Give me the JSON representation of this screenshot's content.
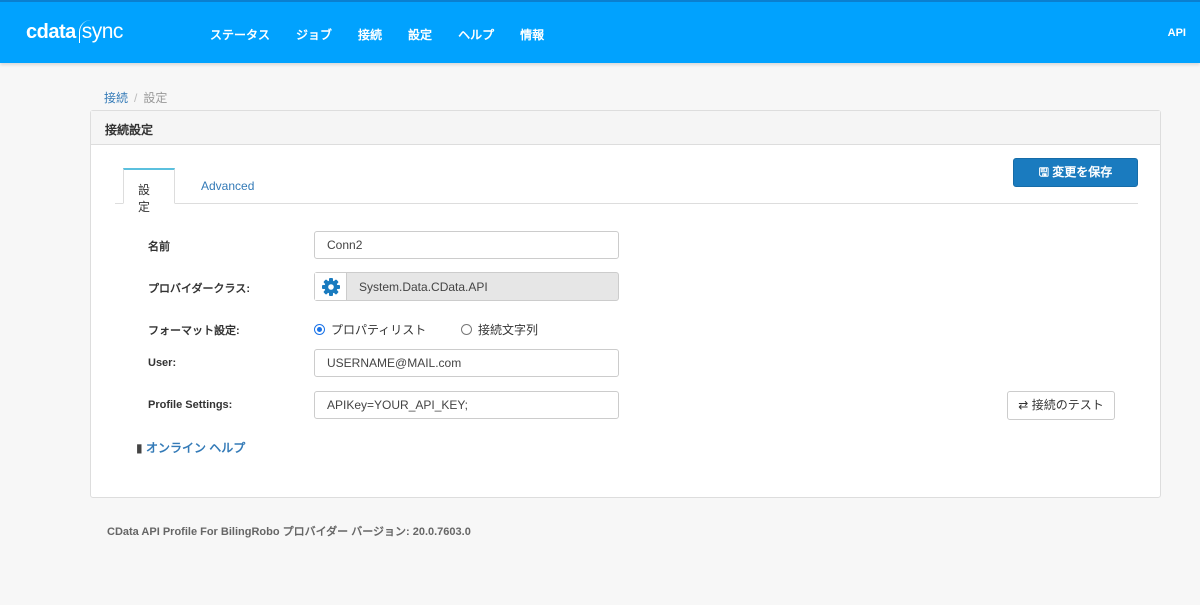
{
  "header": {
    "logo_main": "cdata",
    "logo_sub": "sync",
    "nav": [
      "ステータス",
      "ジョブ",
      "接続",
      "設定",
      "ヘルプ",
      "情報"
    ],
    "api_link": "API"
  },
  "breadcrumb": {
    "parent": "接続",
    "separator": "/",
    "current": "設定"
  },
  "panel": {
    "title": "接続設定",
    "tabs": [
      "設定",
      "Advanced"
    ],
    "save_label": "変更を保存"
  },
  "form": {
    "name_label": "名前",
    "name_value": "Conn2",
    "provider_label": "プロバイダークラス:",
    "provider_value": "System.Data.CData.API",
    "format_label": "フォーマット設定:",
    "format_options": [
      "プロパティリスト",
      "接続文字列"
    ],
    "format_selected": "プロパティリスト",
    "user_label": "User:",
    "user_value": "USERNAME@MAIL.com",
    "profile_label": "Profile Settings:",
    "profile_value": "APIKey=YOUR_API_KEY;",
    "test_label": "接続のテスト",
    "help_label": "オンライン ヘルプ"
  },
  "footer": "CData API Profile For BilingRobo プロバイダー バージョン: 20.0.7603.0",
  "colors": {
    "header": "#01a2fe",
    "primary": "#1a7bbf",
    "link": "#337ab7"
  }
}
